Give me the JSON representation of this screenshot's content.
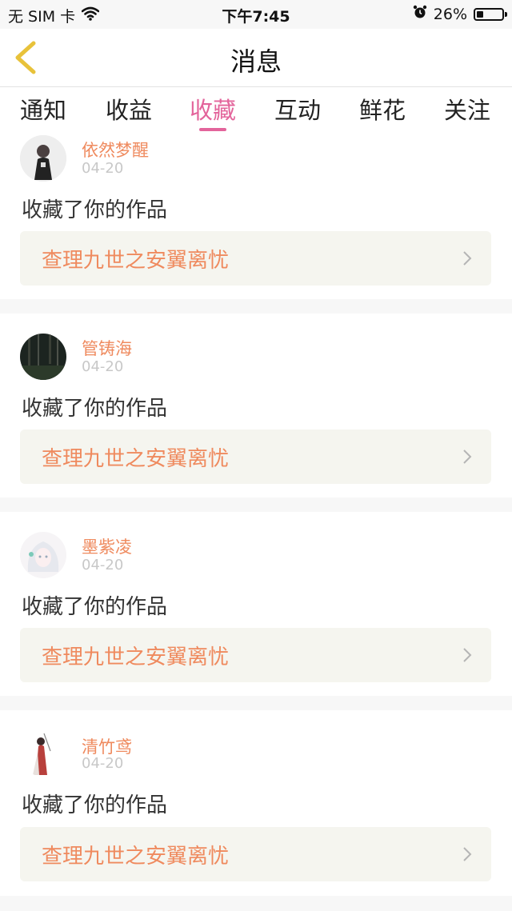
{
  "status_bar": {
    "carrier": "无 SIM 卡",
    "time": "下午7:45",
    "battery_percent": "26%",
    "battery_level": 0.26
  },
  "nav": {
    "title": "消息"
  },
  "tabs": [
    {
      "label": "通知",
      "active": false
    },
    {
      "label": "收益",
      "active": false
    },
    {
      "label": "收藏",
      "active": true
    },
    {
      "label": "互动",
      "active": false
    },
    {
      "label": "鲜花",
      "active": false
    },
    {
      "label": "关注",
      "active": false
    }
  ],
  "messages": [
    {
      "user": "依然梦醒",
      "date": "04-20",
      "text": "收藏了你的作品",
      "work": "查理九世之安翼离忧"
    },
    {
      "user": "管铸海",
      "date": "04-20",
      "text": "收藏了你的作品",
      "work": "查理九世之安翼离忧"
    },
    {
      "user": "墨紫凌",
      "date": "04-20",
      "text": "收藏了你的作品",
      "work": "查理九世之安翼离忧"
    },
    {
      "user": "清竹鸢",
      "date": "04-20",
      "text": "收藏了你的作品",
      "work": "查理九世之安翼离忧"
    }
  ],
  "colors": {
    "accent": "#e3649b",
    "link": "#ef8a5e",
    "card_bg": "#f5f5ef"
  }
}
